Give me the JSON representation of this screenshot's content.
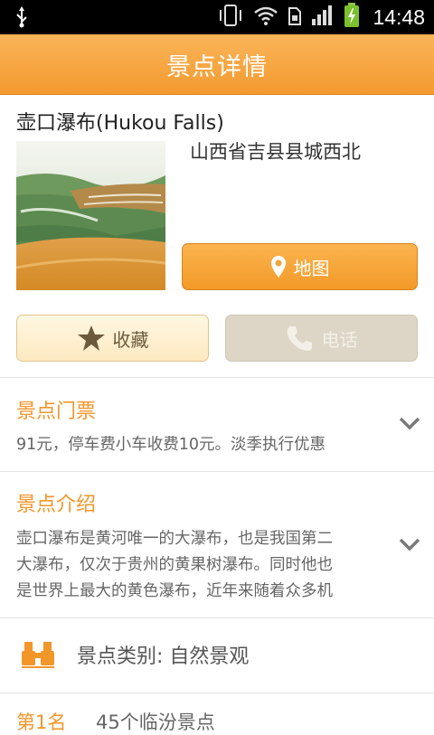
{
  "status_bar": {
    "time": "14:48",
    "icons": [
      "usb-icon",
      "vibrate-icon",
      "wifi-icon",
      "sim-icon",
      "signal-icon",
      "battery-charging-icon"
    ]
  },
  "header": {
    "title": "景点详情"
  },
  "place": {
    "name": "壶口瀑布(Hukou Falls)",
    "address": "山西省吉县县城西北",
    "photo_icon": "scenic-photo"
  },
  "buttons": {
    "map_label": "地图",
    "favorite_label": "收藏",
    "phone_label": "电话"
  },
  "tickets": {
    "title": "景点门票",
    "text": "91元，停车费小车收费10元。淡季执行优惠"
  },
  "intro": {
    "title": "景点介绍",
    "lines": [
      "壶口瀑布是黄河唯一的大瀑布，也是我国第二",
      "大瀑布，仅次于贵州的黄果树瀑布。同时他也",
      "是世界上最大的黄色瀑布，近年来随着众多机"
    ]
  },
  "category": {
    "label": "景点类别: 自然景观"
  },
  "rank": {
    "place": "第1名",
    "note": "45个临汾景点"
  },
  "colors": {
    "accent": "#f2962a",
    "titlebar": "#f7a43a",
    "phone_disabled": "#ddd6c6"
  }
}
